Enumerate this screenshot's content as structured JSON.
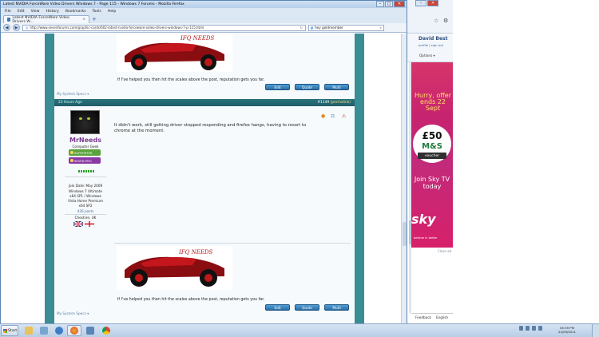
{
  "window": {
    "title": "Latest NVIDIA ForceWare Video Drivers Windows 7 - Page 115 - Windows 7 Forums - Mozilla Firefox",
    "menu": [
      "File",
      "Edit",
      "View",
      "History",
      "Bookmarks",
      "Tools",
      "Help"
    ],
    "tab_label": "Latest NVIDIA ForceWare Video Drivers W...",
    "url": "http://www.sevenforums.com/graphic-cards/602-latest-nvidia-forceware-video-drivers-windows-7-p-115.html",
    "search_query": "hey goldmember"
  },
  "previous_post": {
    "signature_text": "If I've helped you then hit the scales above the post, reputation gets you far.",
    "system_specs": "My System Specs",
    "buttons": [
      "Edit",
      "Quote",
      "Multi"
    ]
  },
  "post": {
    "time": "23 Hours Ago",
    "post_number": "#1149",
    "permalink": "(permalink)",
    "username": "MrNeeds",
    "user_title": "Computer Geek",
    "badges": [
      "SUPPORTER",
      "SEVEN PRO"
    ],
    "join_date": "Join Date: May 2009",
    "os_info": [
      "Windows 7 Ultimate",
      "x64 SP1 / Windows",
      "Vista Home Premium",
      "x64 SP2"
    ],
    "post_count": "426 posts",
    "location": "Cheshire, UK",
    "body": "It didn't work, still getting driver stopped responding and firefox hangs, having to resort to chrome at the moment.",
    "signature_text": "If I've helped you then hit the scales above the post, reputation gets you far.",
    "system_specs": "My System Specs",
    "buttons": [
      "Edit",
      "Quote",
      "Multi"
    ],
    "car_logo_text": "IFQ NEEDS"
  },
  "side": {
    "user_name": "David Best",
    "user_links": "profile  |  sign out",
    "options_label": "Options",
    "ad": {
      "headline": "Hurry, offer ends 22 Sept",
      "amount": "£50",
      "brand": "M&S",
      "voucher": "voucher",
      "cta": "Join Sky TV today",
      "logo": "sky",
      "tagline": "believe in better"
    },
    "close_ad": "Close ad",
    "footer": [
      "Feedback",
      "English"
    ]
  },
  "taskbar": {
    "start": "Start",
    "time": "05:39 PM",
    "date": "22/09/2011"
  },
  "colors": {
    "teal": "#3a8c95",
    "header_teal": "#2a727d",
    "username": "#7a3a8f",
    "ad_pink": "#c62370",
    "button_blue": "#2c6fa6"
  }
}
